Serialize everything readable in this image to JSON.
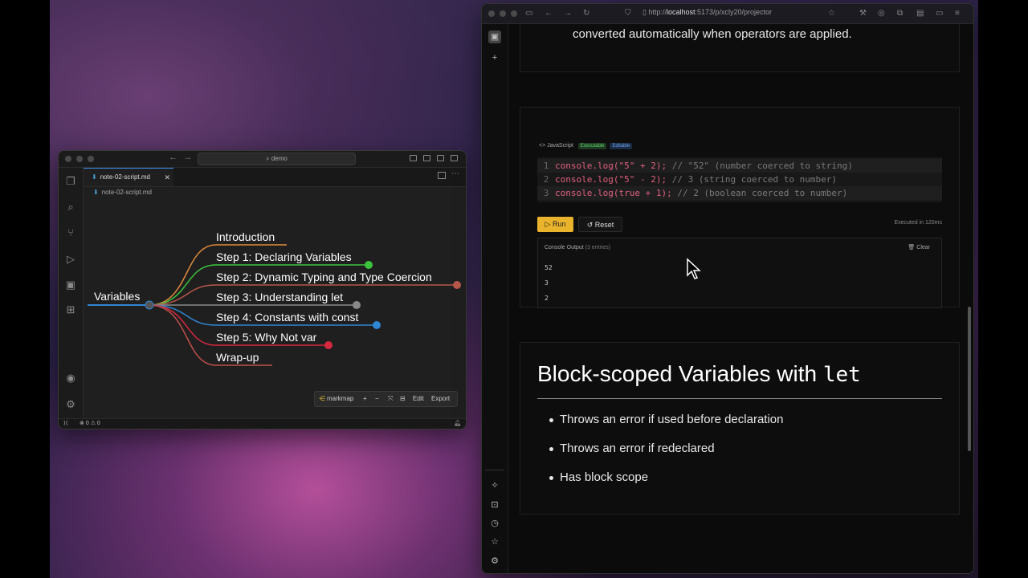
{
  "editor": {
    "search_text": "demo",
    "tab_label": "note-02-script.md",
    "tab_close": "✕",
    "breadcrumb": "note-02-script.md",
    "mindmap": {
      "root": "Variables",
      "branches": [
        {
          "label": "Introduction",
          "color": "#e08a3c"
        },
        {
          "label": "Step 1: Declaring Variables",
          "color": "#3cc43c"
        },
        {
          "label": "Step 2: Dynamic Typing and Type Coercion",
          "color": "#b8574a"
        },
        {
          "label": "Step 3: Understanding let",
          "color": "#888888"
        },
        {
          "label": "Step 4: Constants with const",
          "color": "#2f86d4"
        },
        {
          "label": "Step 5: Why Not var",
          "color": "#d6283e"
        },
        {
          "label": "Wrap-up",
          "color": "#c0504a"
        }
      ]
    },
    "toolbar": {
      "brand": "markmap",
      "plus": "+",
      "minus": "−",
      "edit": "Edit",
      "export": "Export"
    },
    "status": {
      "errors": "0",
      "warnings": "0"
    }
  },
  "browser": {
    "url_prefix": "http://",
    "url_host": "localhost",
    "url_rest": ":5173/p/xcly20/projector",
    "prev_text": "converted automatically when operators are applied.",
    "code_block": {
      "language": "JavaScript",
      "badge_exec": "Executable",
      "badge_edit": "Editable",
      "lines": [
        {
          "num": "1",
          "code": "console.log(\"5\" + 2);",
          "comment": " // \"52\" (number coerced to string)"
        },
        {
          "num": "2",
          "code": "console.log(\"5\" - 2);",
          "comment": " // 3 (string coerced to number)"
        },
        {
          "num": "3",
          "code": "console.log(true + 1);",
          "comment": " // 2 (boolean coerced to number)"
        }
      ],
      "run_label": "Run",
      "reset_label": "Reset",
      "executed": "Executed in 120ms",
      "console_label": "Console Output",
      "console_entries": "(3 entries)",
      "clear_label": "Clear",
      "outputs": [
        "52",
        "3",
        "2"
      ]
    },
    "section": {
      "title_text": "Block-scoped Variables with ",
      "title_code": "let",
      "bullets": [
        "Throws an error if used before declaration",
        "Throws an error if redeclared",
        "Has block scope"
      ]
    }
  },
  "colors": {
    "accent_run": "#e9b32b",
    "badge_exec": "#1f3a22",
    "badge_edit": "#1c2c44",
    "code_text": "#e0607e",
    "comment": "#7a7a7a"
  }
}
